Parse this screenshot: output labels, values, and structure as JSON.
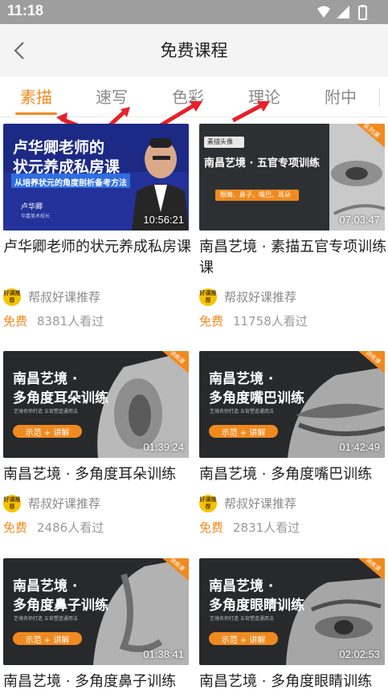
{
  "status": {
    "time": "11:18"
  },
  "header": {
    "title": "免费课程"
  },
  "tabs": [
    {
      "label": "素描",
      "active": true
    },
    {
      "label": "速写",
      "active": false
    },
    {
      "label": "色彩",
      "active": false
    },
    {
      "label": "理论",
      "active": false
    },
    {
      "label": "附中",
      "active": false
    }
  ],
  "colors": {
    "accent": "#f08a1f",
    "annotation_arrow": "#e8202a",
    "tag": "#f08a1f"
  },
  "courses": [
    {
      "thumb": {
        "line1": "卢华卿老师的",
        "line2": "状元养成私房课",
        "subtitle": "从培养状元的角度剖析备考方法",
        "name": "卢华卿",
        "role": "华嘉美术校长"
      },
      "duration": "10:56:21",
      "title": "卢华卿老师的状元养成私房课",
      "publisher": "帮叔好课推荐",
      "price": "免费",
      "views": "8381人看过"
    },
    {
      "thumb": {
        "badge": "素描头像",
        "title": "南昌艺境 · 五官专项训练",
        "tags": "眼睛、鼻子、嘴巴、耳朵",
        "corner": "系列课"
      },
      "duration": "07:03:47",
      "title": "南昌艺境 · 素描五官专项训练课",
      "publisher": "帮叔好课推荐",
      "price": "免费",
      "views": "11758人看过"
    },
    {
      "thumb": {
        "line1": "南昌艺境 ·",
        "line2": "多角度耳朵训练",
        "slogan": "艺境名师打造   五官塑造通用法",
        "button": "示范 + 讲解",
        "corner": "讲练课"
      },
      "duration": "01:39:24",
      "title": "南昌艺境 · 多角度耳朵训练",
      "publisher": "帮叔好课推荐",
      "price": "免费",
      "views": "2486人看过"
    },
    {
      "thumb": {
        "line1": "南昌艺境 ·",
        "line2": "多角度嘴巴训练",
        "slogan": "艺境名师打造   五官塑造通用法",
        "button": "示范 + 讲解",
        "corner": "讲练课"
      },
      "duration": "01:42:49",
      "title": "南昌艺境 · 多角度嘴巴训练",
      "publisher": "帮叔好课推荐",
      "price": "免费",
      "views": "2831人看过"
    },
    {
      "thumb": {
        "line1": "南昌艺境 ·",
        "line2": "多角度鼻子训练",
        "slogan": "艺境名师打造   五官塑造通用法",
        "button": "示范 + 讲解",
        "corner": "讲练课"
      },
      "duration": "01:38:41",
      "title": "南昌艺境 · 多角度鼻子训练"
    },
    {
      "thumb": {
        "line1": "南昌艺境 ·",
        "line2": "多角度眼睛训练",
        "slogan": "艺境名师打造   五官塑造通用法",
        "button": "示范 + 讲解",
        "corner": "讲练课"
      },
      "duration": "02:02:53",
      "title": "南昌艺境 · 多角度眼睛训练"
    }
  ],
  "publisher_icon_text": "好课推荐"
}
